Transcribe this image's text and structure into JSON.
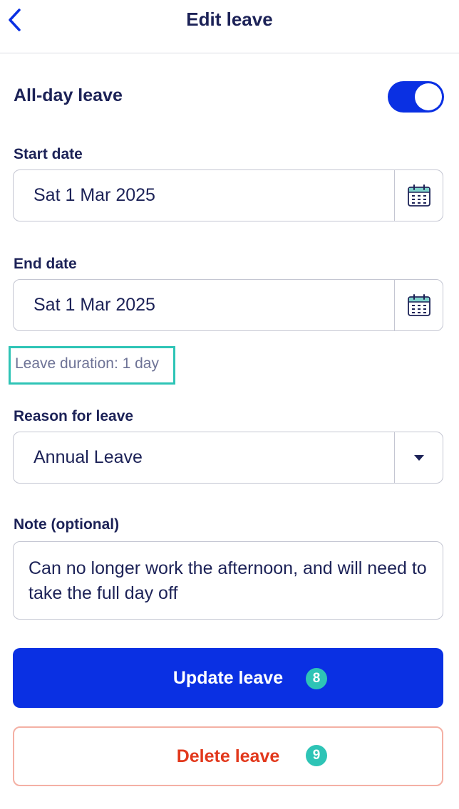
{
  "header": {
    "title": "Edit leave",
    "back_icon": "chevron-left-icon"
  },
  "all_day": {
    "label": "All-day leave",
    "enabled": true
  },
  "start_date": {
    "label": "Start date",
    "value": "Sat 1 Mar 2025",
    "icon": "calendar-icon"
  },
  "end_date": {
    "label": "End date",
    "value": "Sat 1 Mar 2025",
    "icon": "calendar-icon"
  },
  "duration": {
    "text": "Leave duration: 1 day"
  },
  "reason": {
    "label": "Reason for leave",
    "value": "Annual Leave",
    "icon": "caret-down-icon"
  },
  "note": {
    "label": "Note (optional)",
    "value": "Can no longer work the afternoon, and will need to take the full day off"
  },
  "actions": {
    "update_label": "Update leave",
    "update_badge": "8",
    "delete_label": "Delete leave",
    "delete_badge": "9"
  },
  "colors": {
    "primary": "#0a30e3",
    "text": "#1c2257",
    "danger": "#e2381c",
    "highlight": "#2ec4b6"
  }
}
